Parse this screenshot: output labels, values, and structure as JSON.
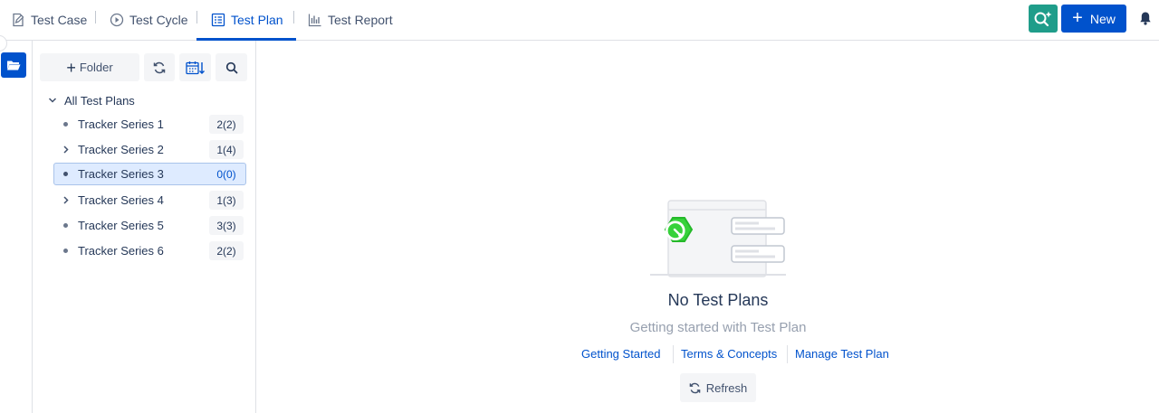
{
  "tabs": [
    {
      "label": "Test Case",
      "icon": "edit-doc-icon",
      "active": false
    },
    {
      "label": "Test Cycle",
      "icon": "play-circle-icon",
      "active": false
    },
    {
      "label": "Test Plan",
      "icon": "plan-list-icon",
      "active": true
    },
    {
      "label": "Test Report",
      "icon": "bar-chart-icon",
      "active": false
    }
  ],
  "header": {
    "new_label": "New",
    "ai_icon": "search-sparkle-icon",
    "bell_icon": "bell-icon"
  },
  "sidebar": {
    "folder_label": "Folder",
    "root_label": "All Test Plans",
    "items": [
      {
        "label": "Tracker Series 1",
        "count": "2(2)",
        "expandable": false,
        "selected": false
      },
      {
        "label": "Tracker Series 2",
        "count": "1(4)",
        "expandable": true,
        "selected": false
      },
      {
        "label": "Tracker Series 3",
        "count": "0(0)",
        "expandable": false,
        "selected": true
      },
      {
        "label": "Tracker Series 4",
        "count": "1(3)",
        "expandable": true,
        "selected": false
      },
      {
        "label": "Tracker Series 5",
        "count": "3(3)",
        "expandable": false,
        "selected": false
      },
      {
        "label": "Tracker Series 6",
        "count": "2(2)",
        "expandable": false,
        "selected": false
      }
    ]
  },
  "empty_state": {
    "title": "No Test Plans",
    "subtitle": "Getting started with Test Plan",
    "links": [
      "Getting Started",
      "Terms & Concepts",
      "Manage Test Plan"
    ],
    "refresh_label": "Refresh"
  },
  "colors": {
    "primary": "#0052cc",
    "ai_button": "#1f9d8a",
    "illustration_accent": "#36d23a",
    "selected_bg": "#deebff"
  }
}
